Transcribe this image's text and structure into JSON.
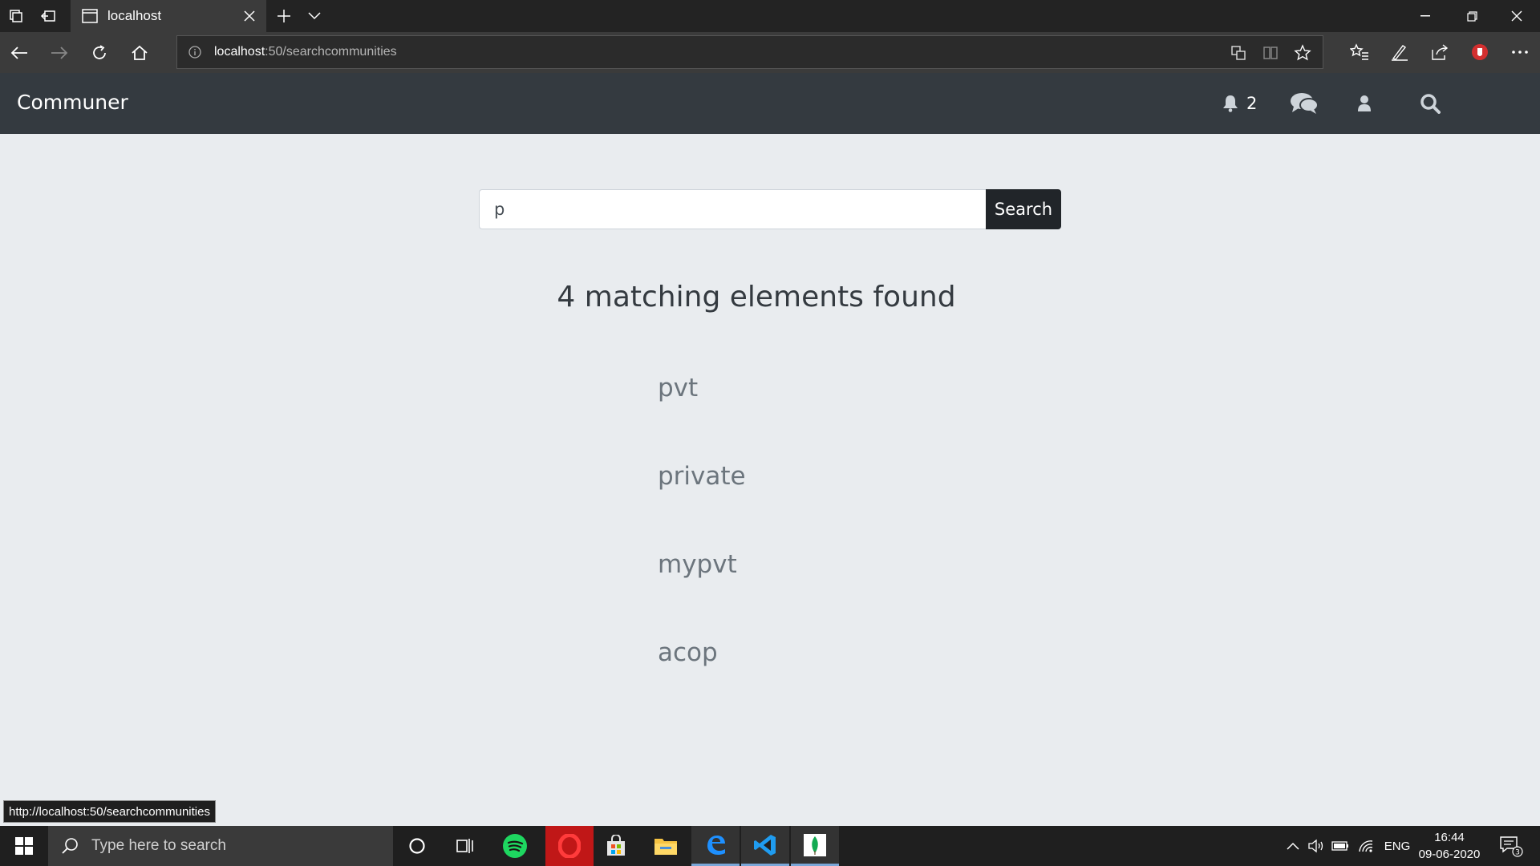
{
  "browser": {
    "tab_title": "localhost",
    "url_host": "localhost",
    "url_path": ":50/searchcommunities",
    "status_url": "http://localhost:50/searchcommunities"
  },
  "app": {
    "brand": "Communer",
    "notification_count": "2"
  },
  "search": {
    "value": "p",
    "button_label": "Search"
  },
  "results": {
    "count_text": "4 matching elements found",
    "items": [
      "pvt",
      "private",
      "mypvt",
      "acop"
    ]
  },
  "taskbar": {
    "search_placeholder": "Type here to search",
    "language": "ENG",
    "time": "16:44",
    "date": "09-06-2020",
    "notification_badge": "3"
  }
}
